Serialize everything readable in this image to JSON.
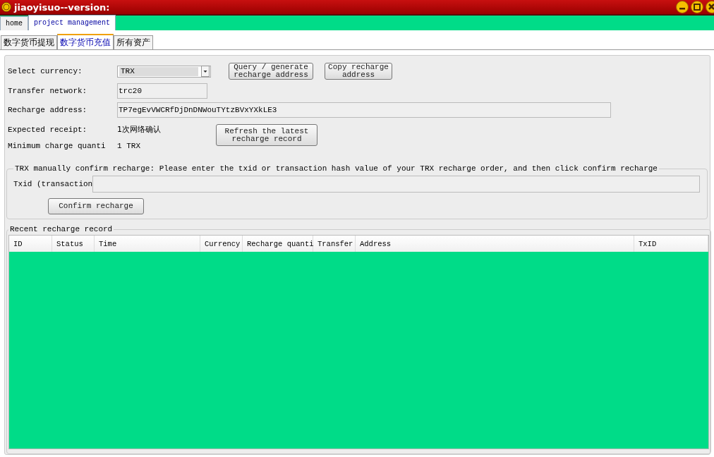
{
  "window": {
    "title": "jiaoyisuo--version:"
  },
  "tabs": [
    {
      "label": "home",
      "selected": false
    },
    {
      "label": "project management",
      "selected": true
    }
  ],
  "subtabs": [
    {
      "label": "数字货币提现",
      "selected": false
    },
    {
      "label": "数字货币充值",
      "selected": true
    },
    {
      "label": "所有资产",
      "selected": false
    }
  ],
  "form": {
    "currency_label": "Select currency:",
    "currency": "TRX",
    "network_label": "Transfer network:",
    "network": "trc20",
    "address_label": "Recharge address:",
    "address": "TP7egEvVWCRfDjDnDNWouTYtzBVxYXkLE3",
    "receipt_label": "Expected receipt:",
    "receipt": "1次网络确认",
    "minimum_label": "Minimum charge quanti",
    "minimum": "1 TRX"
  },
  "buttons": {
    "query": "Query / generate recharge address",
    "copy": "Copy recharge address",
    "refresh": "Refresh the latest recharge record"
  },
  "confirm_group": {
    "title": "TRX manually confirm recharge: Please enter the txid or transaction hash value of your TRX recharge order, and then click confirm recharge",
    "txid_label": "Txid (transaction",
    "button": "Confirm recharge"
  },
  "records": {
    "title": "Recent recharge record",
    "columns": [
      "ID",
      "Status",
      "Time",
      "Currency",
      "Recharge quanti",
      "Transfer",
      "Address",
      "TxID"
    ]
  }
}
